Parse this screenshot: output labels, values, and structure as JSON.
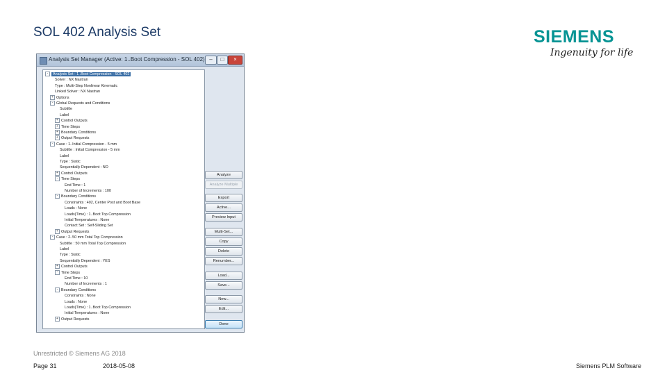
{
  "slide": {
    "title": "SOL 402 Analysis Set",
    "logo_word": "SIEMENS",
    "logo_tagline": "Ingenuity for life"
  },
  "dialog": {
    "title": "Analysis Set Manager (Active: 1..Boot Compression - SOL 402)",
    "window_buttons": [
      "–",
      "□",
      "×"
    ],
    "tree": [
      {
        "text": "Analysis Set : 1..Boot Compression - SOL 402",
        "level": 0,
        "expander": "-",
        "selected": true
      },
      {
        "text": "Solver : NX Nastran",
        "level": 1,
        "expander": ""
      },
      {
        "text": "Type : Multi-Step Nonlinear Kinematic",
        "level": 1,
        "expander": ""
      },
      {
        "text": "Linked Solver : NX Nastran",
        "level": 1,
        "expander": ""
      },
      {
        "text": "Options",
        "level": 1,
        "expander": "+"
      },
      {
        "text": "Global Requests and Conditions",
        "level": 1,
        "expander": "-"
      },
      {
        "text": "Subtitle",
        "level": 2,
        "expander": ""
      },
      {
        "text": "Label",
        "level": 2,
        "expander": ""
      },
      {
        "text": "Control Outputs",
        "level": 2,
        "expander": "+"
      },
      {
        "text": "Time Steps",
        "level": 2,
        "expander": "+"
      },
      {
        "text": "Boundary Conditions",
        "level": 2,
        "expander": "+"
      },
      {
        "text": "Output Requests",
        "level": 2,
        "expander": "+"
      },
      {
        "text": "Case : 1..Initial Compression - 5 mm",
        "level": 1,
        "expander": "-"
      },
      {
        "text": "Subtitle : Initial Compression - 5 mm",
        "level": 2,
        "expander": ""
      },
      {
        "text": "Label",
        "level": 2,
        "expander": ""
      },
      {
        "text": "Type : Static",
        "level": 2,
        "expander": ""
      },
      {
        "text": "Sequentially Dependent : NO",
        "level": 2,
        "expander": ""
      },
      {
        "text": "Control Outputs",
        "level": 2,
        "expander": "+"
      },
      {
        "text": "Time Steps",
        "level": 2,
        "expander": "-"
      },
      {
        "text": "End Time : 1",
        "level": 3,
        "expander": ""
      },
      {
        "text": "Number of Increments : 100",
        "level": 3,
        "expander": ""
      },
      {
        "text": "Boundary Conditions",
        "level": 2,
        "expander": "-"
      },
      {
        "text": "Constraints : 402, Center Post and Boot Base",
        "level": 3,
        "expander": ""
      },
      {
        "text": "Loads : None",
        "level": 3,
        "expander": ""
      },
      {
        "text": "Loads(Time) : 1..Boot Top Compression",
        "level": 3,
        "expander": ""
      },
      {
        "text": "Initial Temperatures : None",
        "level": 3,
        "expander": ""
      },
      {
        "text": "Contact Set : Self-Sliding Set",
        "level": 3,
        "expander": ""
      },
      {
        "text": "Output Requests",
        "level": 2,
        "expander": "+"
      },
      {
        "text": "Case : 2..50 mm Total Top Compression",
        "level": 1,
        "expander": "-"
      },
      {
        "text": "Subtitle : 50 mm Total Top Compression",
        "level": 2,
        "expander": ""
      },
      {
        "text": "Label",
        "level": 2,
        "expander": ""
      },
      {
        "text": "Type : Static",
        "level": 2,
        "expander": ""
      },
      {
        "text": "Sequentially Dependent : YES",
        "level": 2,
        "expander": ""
      },
      {
        "text": "Control Outputs",
        "level": 2,
        "expander": "+"
      },
      {
        "text": "Time Steps",
        "level": 2,
        "expander": "-"
      },
      {
        "text": "End Time : 10",
        "level": 3,
        "expander": ""
      },
      {
        "text": "Number of Increments : 1",
        "level": 3,
        "expander": ""
      },
      {
        "text": "Boundary Conditions",
        "level": 2,
        "expander": "-"
      },
      {
        "text": "Constraints : None",
        "level": 3,
        "expander": ""
      },
      {
        "text": "Loads : None",
        "level": 3,
        "expander": ""
      },
      {
        "text": "Loads(Time) : 1..Boot Top Compression",
        "level": 3,
        "expander": ""
      },
      {
        "text": "Initial Temperatures : None",
        "level": 3,
        "expander": ""
      },
      {
        "text": "Output Requests",
        "level": 2,
        "expander": "+"
      }
    ],
    "buttons": [
      {
        "label": "Analyze",
        "name": "analyze-button",
        "disabled": false
      },
      {
        "label": "Analyze Multiple",
        "name": "analyze-multiple-button",
        "disabled": true
      },
      {
        "label": "Export",
        "name": "export-button",
        "disabled": false
      },
      {
        "label": "Active...",
        "name": "active-button",
        "disabled": false
      },
      {
        "label": "Preview Input",
        "name": "preview-input-button",
        "disabled": false
      },
      {
        "label": "Multi-Set...",
        "name": "multi-set-button",
        "disabled": false
      },
      {
        "label": "Copy",
        "name": "copy-button",
        "disabled": false
      },
      {
        "label": "Delete",
        "name": "delete-button",
        "disabled": false
      },
      {
        "label": "Renumber...",
        "name": "renumber-button",
        "disabled": false
      },
      {
        "label": "Load...",
        "name": "load-button",
        "disabled": false
      },
      {
        "label": "Save...",
        "name": "save-button",
        "disabled": false
      },
      {
        "label": "New...",
        "name": "new-button",
        "disabled": false
      },
      {
        "label": "Edit...",
        "name": "edit-button",
        "disabled": false
      },
      {
        "label": "Done",
        "name": "done-button",
        "disabled": false,
        "default": true
      }
    ]
  },
  "footer": {
    "classification": "Unrestricted © Siemens AG 2018",
    "page": "Page 31",
    "date": "2018-05-08",
    "org": "Siemens PLM Software"
  },
  "colors": {
    "title": "#1c3a66",
    "logo": "#079494",
    "selection": "#3a6ea5"
  }
}
